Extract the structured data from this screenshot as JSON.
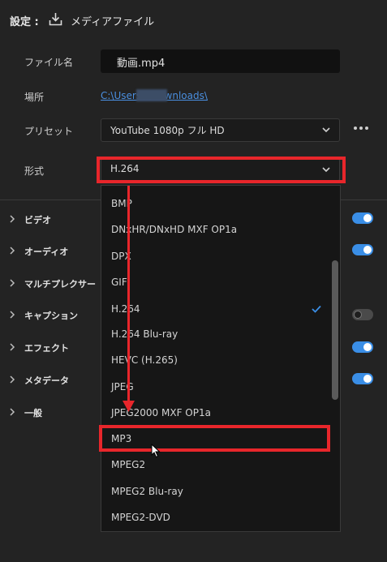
{
  "header": {
    "title": "設定 :",
    "icon": "download-icon",
    "label": "メディアファイル"
  },
  "fields": {
    "filename_label": "ファイル名",
    "filename_value": "動画.mp4",
    "location_label": "場所",
    "location_value": "C:\\Users\\         \\Downloads\\",
    "preset_label": "プリセット",
    "preset_value": "YouTube 1080p フル HD",
    "format_label": "形式",
    "format_value": "H.264"
  },
  "sections": [
    {
      "label": "ビデオ",
      "toggle": "on"
    },
    {
      "label": "オーディオ",
      "toggle": "on"
    },
    {
      "label": "マルチプレクサー",
      "toggle": null
    },
    {
      "label": "キャプション",
      "toggle": "off"
    },
    {
      "label": "エフェクト",
      "toggle": "on"
    },
    {
      "label": "メタデータ",
      "toggle": "on"
    },
    {
      "label": "一般",
      "toggle": null
    }
  ],
  "dropdown": {
    "options": [
      "BMP",
      "DNxHR/DNxHD MXF OP1a",
      "DPX",
      "GIF",
      "H.264",
      "H.264 Blu-ray",
      "HEVC (H.265)",
      "JPEG",
      "JPEG2000 MXF OP1a",
      "MP3",
      "MPEG2",
      "MPEG2 Blu-ray",
      "MPEG2-DVD"
    ],
    "selected": "H.264",
    "highlighted": "MP3"
  },
  "colors": {
    "accent": "#3a8ee6",
    "annotation_red": "#e8262b",
    "link": "#4a8fe0",
    "background": "#232323"
  }
}
